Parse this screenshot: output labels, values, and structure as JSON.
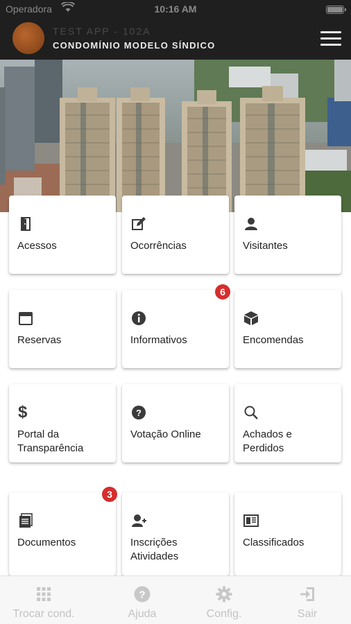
{
  "status_bar": {
    "carrier": "Operadora",
    "time": "10:16 AM",
    "icons": [
      "wifi-icon",
      "battery-icon"
    ]
  },
  "header": {
    "title": "TEST APP - 102A",
    "subtitle": "CONDOMÍNIO MODELO SÍNDICO",
    "icons": [
      "avatar",
      "hamburger-menu-icon"
    ]
  },
  "menu_cards": [
    {
      "label": "Acessos",
      "icon": "door-icon"
    },
    {
      "label": "Ocorrências",
      "icon": "edit-icon"
    },
    {
      "label": "Visitantes",
      "icon": "person-icon"
    },
    {
      "label": "Reservas",
      "icon": "calendar-icon"
    },
    {
      "label": "Informativos",
      "icon": "info-icon",
      "badge": "6"
    },
    {
      "label": "Encomendas",
      "icon": "package-icon"
    },
    {
      "label": "Portal da Transparência",
      "icon": "dollar-icon"
    },
    {
      "label": "Votação Online",
      "icon": "question-icon"
    },
    {
      "label": "Achados e Perdidos",
      "icon": "search-icon"
    },
    {
      "label": "Documentos",
      "icon": "document-icon",
      "badge": "3"
    },
    {
      "label": "Inscrições Atividades",
      "icon": "person-add-icon"
    },
    {
      "label": "Classificados",
      "icon": "newspaper-icon"
    }
  ],
  "bottom_nav": [
    {
      "label": "Trocar cond.",
      "icon": "grid-icon"
    },
    {
      "label": "Ajuda",
      "icon": "help-icon"
    },
    {
      "label": "Config.",
      "icon": "gear-icon"
    },
    {
      "label": "Sair",
      "icon": "logout-icon"
    }
  ],
  "colors": {
    "header_bg": "#1f1f1f",
    "badge": "#d62d2d",
    "icon": "#3b3b3b",
    "nav_inactive": "#c3c3c3"
  }
}
